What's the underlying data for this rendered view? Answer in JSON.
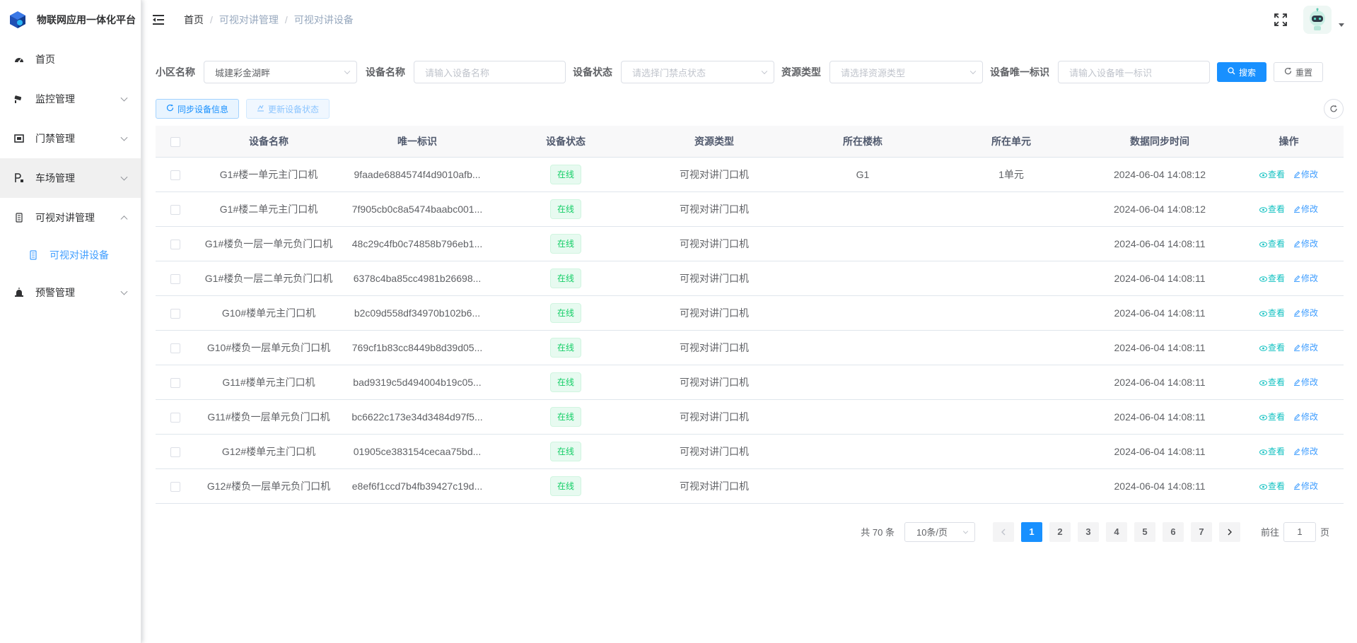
{
  "app": {
    "title": "物联网应用一体化平台"
  },
  "sidebar": {
    "items": [
      {
        "label": "首页",
        "icon": "dashboard-icon"
      },
      {
        "label": "监控管理",
        "icon": "camera-icon"
      },
      {
        "label": "门禁管理",
        "icon": "door-icon"
      },
      {
        "label": "车场管理",
        "icon": "parking-icon"
      },
      {
        "label": "可视对讲管理",
        "icon": "intercom-icon"
      },
      {
        "label": "预警管理",
        "icon": "alarm-icon"
      }
    ],
    "submenu": {
      "label": "可视对讲设备",
      "icon": "intercom-device-icon"
    }
  },
  "breadcrumb": {
    "home": "首页",
    "level1": "可视对讲管理",
    "level2": "可视对讲设备",
    "sep": "/"
  },
  "search": {
    "community_label": "小区名称",
    "community_value": "城建彩金湖畔",
    "device_name_label": "设备名称",
    "device_name_placeholder": "请输入设备名称",
    "device_status_label": "设备状态",
    "device_status_placeholder": "请选择门禁点状态",
    "resource_type_label": "资源类型",
    "resource_type_placeholder": "请选择资源类型",
    "device_id_label": "设备唯一标识",
    "device_id_placeholder": "请输入设备唯一标识",
    "search_button": "搜索",
    "reset_button": "重置"
  },
  "toolbar": {
    "sync_button": "同步设备信息",
    "update_button": "更新设备状态"
  },
  "table": {
    "headers": [
      "设备名称",
      "唯一标识",
      "设备状态",
      "资源类型",
      "所在楼栋",
      "所在单元",
      "数据同步时间",
      "操作"
    ],
    "view_label": "查看",
    "edit_label": "修改",
    "rows": [
      {
        "name": "G1#楼一单元主门口机",
        "id": "9faade6884574f4d9010afb...",
        "status": "在线",
        "type": "可视对讲门口机",
        "building": "G1",
        "unit": "1单元",
        "time": "2024-06-04 14:08:12"
      },
      {
        "name": "G1#楼二单元主门口机",
        "id": "7f905cb0c8a5474baabc001...",
        "status": "在线",
        "type": "可视对讲门口机",
        "building": "",
        "unit": "",
        "time": "2024-06-04 14:08:12"
      },
      {
        "name": "G1#楼负一层一单元负门口机",
        "id": "48c29c4fb0c74858b796eb1...",
        "status": "在线",
        "type": "可视对讲门口机",
        "building": "",
        "unit": "",
        "time": "2024-06-04 14:08:11"
      },
      {
        "name": "G1#楼负一层二单元负门口机",
        "id": "6378c4ba85cc4981b26698...",
        "status": "在线",
        "type": "可视对讲门口机",
        "building": "",
        "unit": "",
        "time": "2024-06-04 14:08:11"
      },
      {
        "name": "G10#楼单元主门口机",
        "id": "b2c09d558df34970b102b6...",
        "status": "在线",
        "type": "可视对讲门口机",
        "building": "",
        "unit": "",
        "time": "2024-06-04 14:08:11"
      },
      {
        "name": "G10#楼负一层单元负门口机",
        "id": "769cf1b83cc8449b8d39d05...",
        "status": "在线",
        "type": "可视对讲门口机",
        "building": "",
        "unit": "",
        "time": "2024-06-04 14:08:11"
      },
      {
        "name": "G11#楼单元主门口机",
        "id": "bad9319c5d494004b19c05...",
        "status": "在线",
        "type": "可视对讲门口机",
        "building": "",
        "unit": "",
        "time": "2024-06-04 14:08:11"
      },
      {
        "name": "G11#楼负一层单元负门口机",
        "id": "bc6622c173e34d3484d97f5...",
        "status": "在线",
        "type": "可视对讲门口机",
        "building": "",
        "unit": "",
        "time": "2024-06-04 14:08:11"
      },
      {
        "name": "G12#楼单元主门口机",
        "id": "01905ce383154cecaa75bd...",
        "status": "在线",
        "type": "可视对讲门口机",
        "building": "",
        "unit": "",
        "time": "2024-06-04 14:08:11"
      },
      {
        "name": "G12#楼负一层单元负门口机",
        "id": "e8ef6f1ccd7b4fb39427c19d...",
        "status": "在线",
        "type": "可视对讲门口机",
        "building": "",
        "unit": "",
        "time": "2024-06-04 14:08:11"
      }
    ]
  },
  "pagination": {
    "total": "共 70 条",
    "page_size": "10条/页",
    "pages": [
      "1",
      "2",
      "3",
      "4",
      "5",
      "6",
      "7"
    ],
    "current": "1",
    "goto_label": "前往",
    "goto_value": "1",
    "page_suffix": "页"
  },
  "colors": {
    "primary": "#1890ff",
    "success": "#13ce66",
    "link": "#409eff"
  }
}
